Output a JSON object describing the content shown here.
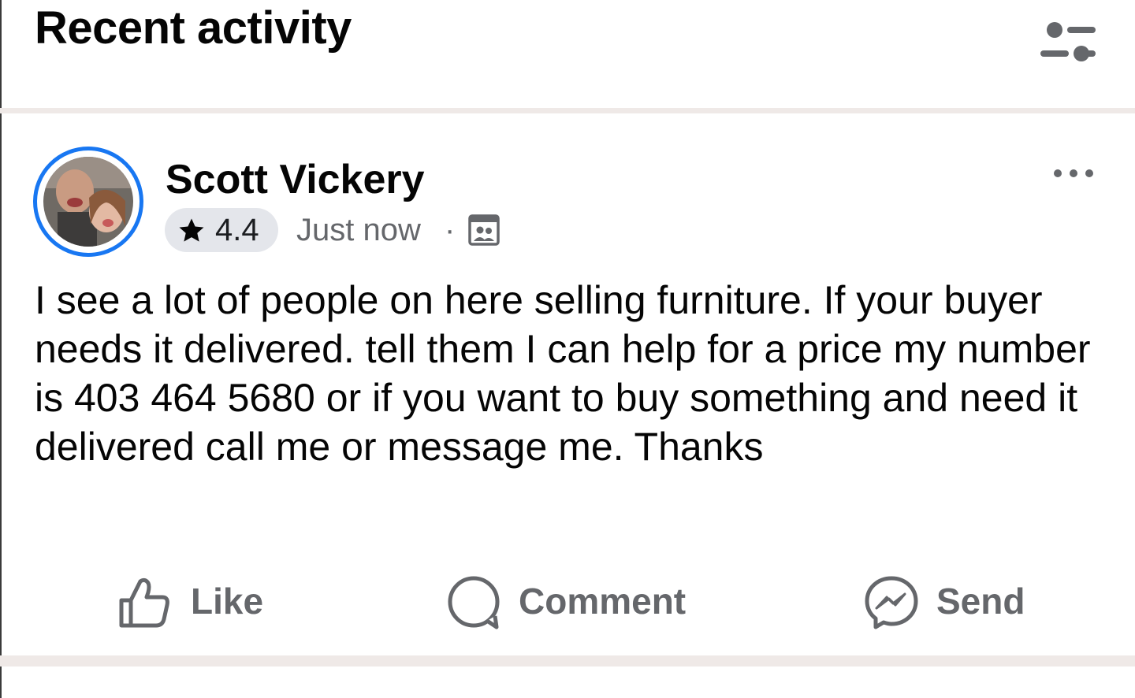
{
  "header": {
    "title": "Recent activity",
    "filter_icon": "sliders-icon"
  },
  "post": {
    "author": "Scott Vickery",
    "rating": "4.4",
    "timestamp": "Just now",
    "separator": "·",
    "audience_icon": "group-audience-icon",
    "more_icon": "more-dots-icon",
    "text": "I see a lot of people on here selling furniture. If your buyer needs it delivered. tell them I can help for a price my number is 403 464 5680 or if you want to buy something and need it delivered call me or message me. Thanks",
    "actions": {
      "like": "Like",
      "comment": "Comment",
      "send": "Send"
    }
  },
  "colors": {
    "accent": "#1877f2",
    "secondary_text": "#65676b",
    "pill_bg": "#e4e6eb",
    "separator": "#efe9e7"
  }
}
